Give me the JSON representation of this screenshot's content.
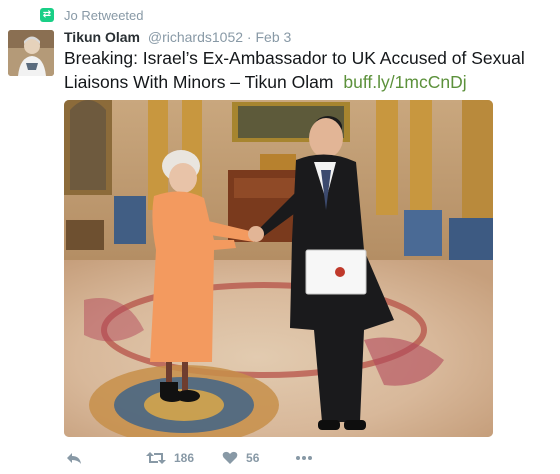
{
  "retweet": {
    "label": "Jo Retweeted",
    "icon": "retweet-icon",
    "badge_color": "#19cf86"
  },
  "tweet": {
    "display_name": "Tikun Olam",
    "handle": "@richards1052",
    "separator": "·",
    "date": "Feb 3",
    "text": "Breaking: Israel’s Ex-Ambassador to UK Accused of Sexual Liaisons With Minors – Tikun Olam",
    "link": "buff.ly/1mcCnDj",
    "link_color": "#5c913b"
  },
  "actions": {
    "reply_icon": "reply-icon",
    "retweet_icon": "retweet-icon",
    "retweet_count": "186",
    "like_icon": "heart-icon",
    "like_count": "56",
    "more_icon": "more-icon"
  }
}
